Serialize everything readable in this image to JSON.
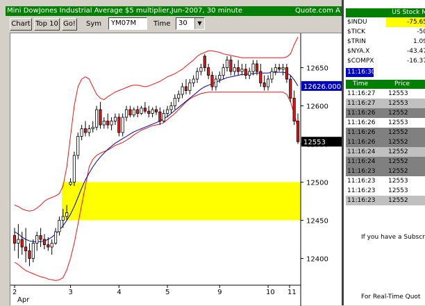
{
  "window": {
    "title": "Mini DowJones Industrial Average $5 multiplier,Jun-2007, 30 minute",
    "title_right": "Quote.com  A"
  },
  "toolbar": {
    "chart_button": "Chart",
    "top10_button": "Top 10",
    "go_button": "Go!",
    "sym_label": "Sym",
    "sym_value": "YM07M",
    "time_label": "Time",
    "time_value": "30"
  },
  "chart_data": {
    "type": "candlestick",
    "y_ticks": [
      "12650",
      "12600",
      "12550",
      "12500",
      "12450",
      "12400"
    ],
    "x_ticks": [
      "2",
      "3",
      "4",
      "5",
      "9",
      "10",
      "11"
    ],
    "x_subtitle": "Apr",
    "ylim": [
      12365,
      12695
    ],
    "current_price_label": "12626.000",
    "last_price_label": "12553",
    "highlight_zone": [
      12450,
      12500
    ],
    "highlight_color": "#ffff00",
    "colors": {
      "up_candle": "#ffffff",
      "down_candle": "#e01818",
      "ma_line": "#0000a0",
      "bollinger": "#e01818"
    },
    "candles": [
      [
        12430,
        12440,
        12410,
        12420
      ],
      [
        12420,
        12445,
        12400,
        12425
      ],
      [
        12425,
        12435,
        12405,
        12415
      ],
      [
        12415,
        12440,
        12395,
        12410
      ],
      [
        12410,
        12420,
        12390,
        12400
      ],
      [
        12400,
        12425,
        12395,
        12420
      ],
      [
        12420,
        12435,
        12410,
        12430
      ],
      [
        12430,
        12440,
        12415,
        12425
      ],
      [
        12425,
        12432,
        12412,
        12418
      ],
      [
        12418,
        12428,
        12410,
        12415
      ],
      [
        12415,
        12425,
        12405,
        12420
      ],
      [
        12420,
        12440,
        12418,
        12435
      ],
      [
        12435,
        12455,
        12430,
        12450
      ],
      [
        12450,
        12465,
        12440,
        12455
      ],
      [
        12455,
        12470,
        12450,
        12460
      ],
      [
        12497,
        12505,
        12495,
        12500
      ],
      [
        12500,
        12540,
        12495,
        12535
      ],
      [
        12535,
        12565,
        12530,
        12560
      ],
      [
        12560,
        12575,
        12555,
        12570
      ],
      [
        12570,
        12580,
        12560,
        12565
      ],
      [
        12565,
        12575,
        12560,
        12570
      ],
      [
        12570,
        12580,
        12565,
        12572
      ],
      [
        12572,
        12600,
        12568,
        12595
      ],
      [
        12595,
        12605,
        12570,
        12575
      ],
      [
        12575,
        12585,
        12570,
        12580
      ],
      [
        12580,
        12590,
        12570,
        12575
      ],
      [
        12575,
        12585,
        12568,
        12580
      ],
      [
        12580,
        12590,
        12575,
        12585
      ],
      [
        12585,
        12590,
        12560,
        12565
      ],
      [
        12565,
        12590,
        12560,
        12585
      ],
      [
        12585,
        12600,
        12580,
        12595
      ],
      [
        12595,
        12600,
        12585,
        12588
      ],
      [
        12588,
        12598,
        12585,
        12595
      ],
      [
        12595,
        12600,
        12585,
        12590
      ],
      [
        12590,
        12600,
        12588,
        12597
      ],
      [
        12597,
        12605,
        12590,
        12593
      ],
      [
        12593,
        12600,
        12585,
        12590
      ],
      [
        12590,
        12598,
        12585,
        12595
      ],
      [
        12595,
        12600,
        12588,
        12592
      ],
      [
        12592,
        12598,
        12575,
        12580
      ],
      [
        12580,
        12595,
        12578,
        12590
      ],
      [
        12590,
        12600,
        12585,
        12595
      ],
      [
        12595,
        12605,
        12590,
        12600
      ],
      [
        12600,
        12615,
        12595,
        12610
      ],
      [
        12610,
        12620,
        12605,
        12615
      ],
      [
        12615,
        12630,
        12610,
        12625
      ],
      [
        12625,
        12635,
        12615,
        12620
      ],
      [
        12620,
        12635,
        12615,
        12630
      ],
      [
        12630,
        12640,
        12625,
        12635
      ],
      [
        12635,
        12650,
        12630,
        12645
      ],
      [
        12645,
        12655,
        12640,
        12650
      ],
      [
        12665,
        12668,
        12645,
        12650
      ],
      [
        12650,
        12655,
        12635,
        12640
      ],
      [
        12640,
        12645,
        12620,
        12625
      ],
      [
        12625,
        12640,
        12620,
        12635
      ],
      [
        12635,
        12645,
        12630,
        12640
      ],
      [
        12640,
        12655,
        12635,
        12650
      ],
      [
        12650,
        12665,
        12645,
        12660
      ],
      [
        12660,
        12665,
        12640,
        12645
      ],
      [
        12645,
        12655,
        12640,
        12650
      ],
      [
        12650,
        12660,
        12640,
        12645
      ],
      [
        12645,
        12655,
        12640,
        12648
      ],
      [
        12648,
        12655,
        12635,
        12640
      ],
      [
        12640,
        12650,
        12635,
        12645
      ],
      [
        12645,
        12660,
        12640,
        12655
      ],
      [
        12655,
        12660,
        12640,
        12645
      ],
      [
        12645,
        12655,
        12625,
        12630
      ],
      [
        12630,
        12640,
        12620,
        12625
      ],
      [
        12625,
        12640,
        12620,
        12635
      ],
      [
        12635,
        12650,
        12630,
        12645
      ],
      [
        12645,
        12655,
        12640,
        12650
      ],
      [
        12650,
        12655,
        12645,
        12648
      ],
      [
        12648,
        12655,
        12640,
        12650
      ],
      [
        12650,
        12655,
        12630,
        12635
      ],
      [
        12635,
        12640,
        12605,
        12610
      ],
      [
        12610,
        12620,
        12575,
        12580
      ],
      [
        12580,
        12590,
        12550,
        12553
      ]
    ],
    "ma": [
      12435,
      12432,
      12428,
      12425,
      12423,
      12422,
      12422,
      12422,
      12423,
      12425,
      12428,
      12432,
      12437,
      12443,
      12450,
      12458,
      12468,
      12480,
      12492,
      12503,
      12512,
      12520,
      12527,
      12533,
      12538,
      12543,
      12547,
      12551,
      12554,
      12557,
      12560,
      12563,
      12566,
      12568,
      12570,
      12572,
      12574,
      12576,
      12578,
      12580,
      12583,
      12586,
      12590,
      12594,
      12598,
      12602,
      12606,
      12610,
      12614,
      12618,
      12622,
      12625,
      12627,
      12629,
      12631,
      12633,
      12635,
      12637,
      12638,
      12639,
      12640,
      12641,
      12641,
      12642,
      12642,
      12643,
      12643,
      12643,
      12643,
      12644,
      12644,
      12644,
      12644,
      12643,
      12640,
      12634,
      12626
    ],
    "bb_upper": [
      12470,
      12468,
      12465,
      12463,
      12462,
      12463,
      12466,
      12470,
      12475,
      12478,
      12480,
      12482,
      12485,
      12495,
      12520,
      12560,
      12600,
      12625,
      12635,
      12638,
      12635,
      12625,
      12615,
      12610,
      12608,
      12612,
      12615,
      12618,
      12620,
      12622,
      12624,
      12626,
      12627,
      12627,
      12626,
      12625,
      12626,
      12628,
      12630,
      12632,
      12635,
      12638,
      12640,
      12642,
      12645,
      12648,
      12652,
      12656,
      12660,
      12665,
      12668,
      12670,
      12672,
      12672,
      12671,
      12670,
      12668,
      12667,
      12666,
      12665,
      12664,
      12663,
      12663,
      12663,
      12663,
      12663,
      12663,
      12663,
      12663,
      12663,
      12663,
      12663,
      12663,
      12664,
      12668,
      12680,
      12690
    ],
    "bb_lower": [
      12395,
      12392,
      12388,
      12384,
      12382,
      12380,
      12378,
      12376,
      12375,
      12373,
      12372,
      12371,
      12372,
      12375,
      12385,
      12400,
      12420,
      12445,
      12470,
      12495,
      12520,
      12530,
      12535,
      12538,
      12540,
      12542,
      12545,
      12548,
      12550,
      12552,
      12555,
      12558,
      12562,
      12565,
      12568,
      12570,
      12572,
      12574,
      12575,
      12576,
      12578,
      12582,
      12586,
      12590,
      12595,
      12600,
      12605,
      12609,
      12612,
      12614,
      12616,
      12617,
      12618,
      12618,
      12618,
      12618,
      12618,
      12618,
      12618,
      12618,
      12618,
      12618,
      12618,
      12618,
      12618,
      12618,
      12618,
      12618,
      12618,
      12618,
      12618,
      12618,
      12618,
      12615,
      12605,
      12590,
      12570
    ]
  },
  "index_panel": {
    "header": "US Stock M",
    "rows": [
      {
        "sym": "$INDU",
        "val": "-75.65"
      },
      {
        "sym": "$TICK",
        "val": "-50"
      },
      {
        "sym": "$TRIN",
        "val": "1.09"
      },
      {
        "sym": "$NYA.X",
        "val": "-43.47"
      },
      {
        "sym": "$COMPX",
        "val": "-16.37"
      }
    ],
    "clock": "11:16:30"
  },
  "time_sales": {
    "col_time": "Time",
    "col_price": "Price",
    "rows": [
      {
        "time": "11:16:27",
        "price": "12553"
      },
      {
        "time": "11:16:27",
        "price": "12553"
      },
      {
        "time": "11:16:26",
        "price": "12552"
      },
      {
        "time": "11:16:26",
        "price": "12553"
      },
      {
        "time": "11:16:26",
        "price": "12552"
      },
      {
        "time": "11:16:26",
        "price": "12552"
      },
      {
        "time": "11:16:24",
        "price": "12552"
      },
      {
        "time": "11:16:24",
        "price": "12552"
      },
      {
        "time": "11:16:23",
        "price": "12552"
      },
      {
        "time": "11:16:23",
        "price": "12553"
      },
      {
        "time": "11:16:23",
        "price": "12553"
      },
      {
        "time": "11:16:23",
        "price": "12552"
      }
    ],
    "row_styles": [
      "w",
      "g",
      "dk",
      "w",
      "dk",
      "dk",
      "g",
      "dk",
      "dk",
      "w",
      "w",
      "g"
    ]
  },
  "messages": {
    "subscription": "If you have a Subscr",
    "realtime": "For Real-Time Quot"
  }
}
